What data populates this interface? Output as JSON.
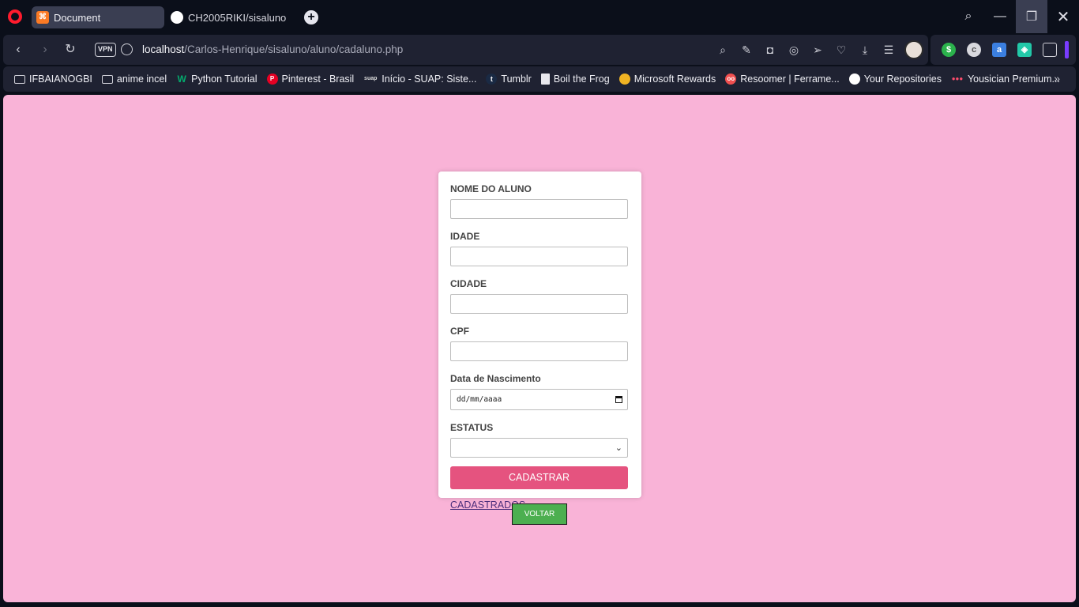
{
  "browser": {
    "tabs": [
      {
        "title": "Document",
        "active": true
      },
      {
        "title": "CH2005RIKI/sisaluno",
        "active": false
      }
    ],
    "address": {
      "vpn_label": "VPN",
      "host": "localhost",
      "path": "/Carlos-Henrique/sisaluno/aluno/cadaluno.php"
    },
    "bookmarks": [
      {
        "label": "IFBAIANOGBI",
        "icon": "folder-icon"
      },
      {
        "label": "anime incel",
        "icon": "folder-icon"
      },
      {
        "label": "Python Tutorial",
        "icon": "w3schools-icon"
      },
      {
        "label": "Pinterest - Brasil",
        "icon": "pinterest-icon"
      },
      {
        "label": "Início - SUAP: Siste...",
        "icon": "suap-icon"
      },
      {
        "label": "Tumblr",
        "icon": "tumblr-icon"
      },
      {
        "label": "Boil the Frog",
        "icon": "document-icon"
      },
      {
        "label": "Microsoft Rewards",
        "icon": "medal-icon"
      },
      {
        "label": "Resoomer | Ferrame...",
        "icon": "resoomer-icon"
      },
      {
        "label": "Your Repositories",
        "icon": "github-icon"
      },
      {
        "label": "Yousician Premium...",
        "icon": "yousician-icon"
      }
    ]
  },
  "form": {
    "nome_label": "NOME DO ALUNO",
    "nome_value": "",
    "idade_label": "IDADE",
    "idade_value": "",
    "cidade_label": "CIDADE",
    "cidade_value": "",
    "cpf_label": "CPF",
    "cpf_value": "",
    "nascimento_label": "Data de Nascimento",
    "nascimento_placeholder": "dd/mm/aaaa",
    "status_label": "ESTATUS",
    "status_value": "",
    "submit_label": "CADASTRAR",
    "cadastrados_link": "CADASTRADOS"
  },
  "back_button": "VOLTAR",
  "colors": {
    "page_background": "#f9b3d7",
    "submit_button": "#e5537f",
    "back_button": "#4caf50"
  }
}
